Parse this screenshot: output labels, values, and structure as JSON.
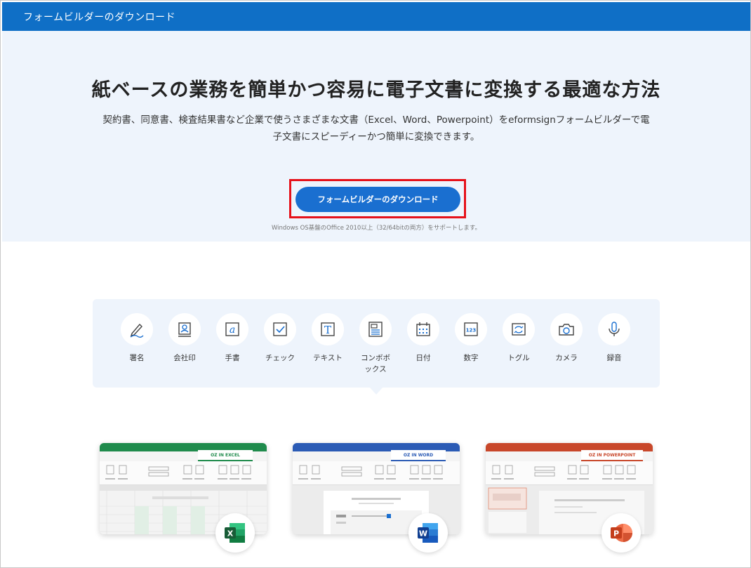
{
  "header": {
    "title": "フォームビルダーのダウンロード"
  },
  "hero": {
    "title": "紙ベースの業務を簡単かつ容易に電子文書に変換する最適な方法",
    "description_line1": "契約書、同意書、検査結果書など企業で使うさまざまな文書（Excel、Word、Powerpoint）をeformsignフォームビルダーで電",
    "description_line2": "子文書にスピーディーかつ簡単に変換できます。",
    "download_button": "フォームビルダーのダウンロード",
    "support_note": "Windows OS基盤のOffice 2010以上（32/64bitの両方）をサポートします。"
  },
  "tools": [
    {
      "label": "署名",
      "icon": "signature-icon"
    },
    {
      "label": "会社印",
      "icon": "company-stamp-icon"
    },
    {
      "label": "手書",
      "icon": "handwriting-icon"
    },
    {
      "label": "チェック",
      "icon": "checkbox-icon"
    },
    {
      "label": "テキスト",
      "icon": "text-icon"
    },
    {
      "label": "コンボボ\nックス",
      "icon": "combobox-icon"
    },
    {
      "label": "日付",
      "icon": "calendar-icon"
    },
    {
      "label": "数字",
      "icon": "number-icon"
    },
    {
      "label": "トグル",
      "icon": "toggle-icon"
    },
    {
      "label": "カメラ",
      "icon": "camera-icon"
    },
    {
      "label": "録音",
      "icon": "microphone-icon"
    }
  ],
  "cards": [
    {
      "tab": "OZ IN EXCEL",
      "app": "excel",
      "letter": "X"
    },
    {
      "tab": "OZ IN WORD",
      "app": "word",
      "letter": "W"
    },
    {
      "tab": "OZ IN POWERPOINT",
      "app": "powerpoint",
      "letter": "P"
    }
  ],
  "colors": {
    "topbar": "#0f6fc6",
    "hero_bg": "#eef4fc",
    "button": "#1a6fd0",
    "highlight": "#e6111a",
    "excel": "#1f8b4c",
    "word": "#2b5bb5",
    "powerpoint": "#c8472a"
  }
}
